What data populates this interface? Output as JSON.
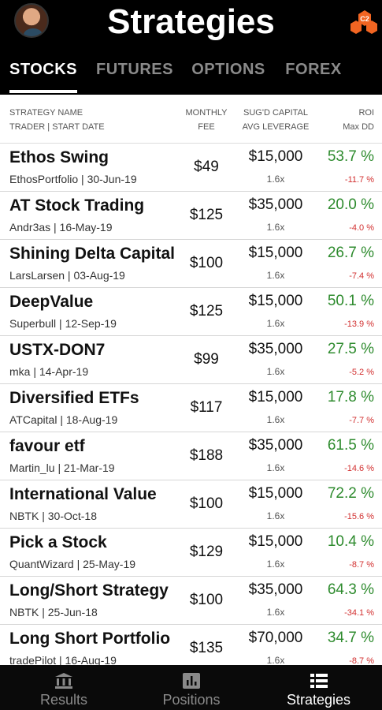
{
  "header": {
    "title": "Strategies",
    "logo_text": "C2"
  },
  "tabs": [
    {
      "label": "STOCKS",
      "active": true
    },
    {
      "label": "FUTURES",
      "active": false
    },
    {
      "label": "OPTIONS",
      "active": false
    },
    {
      "label": "FOREX",
      "active": false
    }
  ],
  "columns": {
    "name_line1": "STRATEGY NAME",
    "name_line2": "TRADER | START DATE",
    "fee_line1": "MONTHLY",
    "fee_line2": "FEE",
    "cap_line1": "SUG'D CAPITAL",
    "cap_line2": "AVG LEVERAGE",
    "roi_line1": "ROI",
    "roi_line2": "Max DD"
  },
  "strategies": [
    {
      "name": "Ethos Swing",
      "meta": "EthosPortfolio | 30-Jun-19",
      "fee": "$49",
      "capital": "$15,000",
      "leverage": "1.6x",
      "roi": "53.7 %",
      "maxdd": "-11.7 %"
    },
    {
      "name": "AT Stock Trading",
      "meta": "Andr3as | 16-May-19",
      "fee": "$125",
      "capital": "$35,000",
      "leverage": "1.6x",
      "roi": "20.0 %",
      "maxdd": "-4.0 %"
    },
    {
      "name": "Shining Delta Capital",
      "meta": "LarsLarsen | 03-Aug-19",
      "fee": "$100",
      "capital": "$15,000",
      "leverage": "1.6x",
      "roi": "26.7 %",
      "maxdd": "-7.4 %"
    },
    {
      "name": "DeepValue",
      "meta": "Superbull | 12-Sep-19",
      "fee": "$125",
      "capital": "$15,000",
      "leverage": "1.6x",
      "roi": "50.1 %",
      "maxdd": "-13.9 %"
    },
    {
      "name": "USTX-DON7",
      "meta": "mka | 14-Apr-19",
      "fee": "$99",
      "capital": "$35,000",
      "leverage": "1.6x",
      "roi": "27.5 %",
      "maxdd": "-5.2 %"
    },
    {
      "name": "Diversified ETFs",
      "meta": "ATCapital | 18-Aug-19",
      "fee": "$117",
      "capital": "$15,000",
      "leverage": "1.6x",
      "roi": "17.8 %",
      "maxdd": "-7.7 %"
    },
    {
      "name": "favour etf",
      "meta": "Martin_lu | 21-Mar-19",
      "fee": "$188",
      "capital": "$35,000",
      "leverage": "1.6x",
      "roi": "61.5 %",
      "maxdd": "-14.6 %"
    },
    {
      "name": "International Value",
      "meta": "NBTK | 30-Oct-18",
      "fee": "$100",
      "capital": "$15,000",
      "leverage": "1.6x",
      "roi": "72.2 %",
      "maxdd": "-15.6 %"
    },
    {
      "name": "Pick a Stock",
      "meta": "QuantWizard | 25-May-19",
      "fee": "$129",
      "capital": "$15,000",
      "leverage": "1.6x",
      "roi": "10.4 %",
      "maxdd": "-8.7 %"
    },
    {
      "name": "Long/Short Strategy",
      "meta": "NBTK | 25-Jun-18",
      "fee": "$100",
      "capital": "$35,000",
      "leverage": "1.6x",
      "roi": "64.3 %",
      "maxdd": "-34.1 %"
    },
    {
      "name": "Long Short Portfolio",
      "meta": "tradePilot | 16-Aug-19",
      "fee": "$135",
      "capital": "$70,000",
      "leverage": "1.6x",
      "roi": "34.7 %",
      "maxdd": "-8.7 %"
    }
  ],
  "bottom_nav": [
    {
      "label": "Results",
      "icon": "bank-icon",
      "active": false
    },
    {
      "label": "Positions",
      "icon": "bar-chart-icon",
      "active": false
    },
    {
      "label": "Strategies",
      "icon": "list-icon",
      "active": true
    }
  ],
  "colors": {
    "roi_positive": "#2e8b2e",
    "drawdown": "#d23030",
    "logo_orange": "#f26522"
  }
}
